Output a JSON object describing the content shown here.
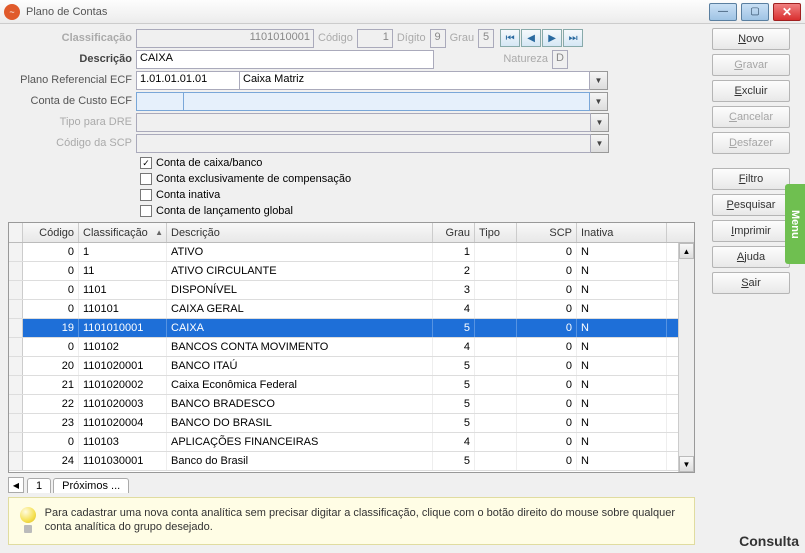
{
  "window": {
    "title": "Plano de Contas"
  },
  "labels": {
    "classificacao": "Classificação",
    "codigo": "Código",
    "digito": "Dígito",
    "grau": "Grau",
    "descricao": "Descrição",
    "natureza": "Natureza",
    "planoRef": "Plano Referencial ECF",
    "contaCusto": "Conta de Custo ECF",
    "tipoDRE": "Tipo para DRE",
    "codigoSCP": "Código da SCP"
  },
  "values": {
    "classificacao": "1101010001",
    "codigo": "1",
    "digito": "9",
    "grau": "5",
    "descricao": "CAIXA",
    "natureza": "D",
    "planoRefCod": "1.01.01.01.01",
    "planoRefDesc": "Caixa Matriz",
    "contaCusto": "",
    "tipoDRE": "",
    "codigoSCP": ""
  },
  "checks": [
    {
      "label": "Conta de caixa/banco",
      "checked": true
    },
    {
      "label": "Conta exclusivamente de compensação",
      "checked": false
    },
    {
      "label": "Conta inativa",
      "checked": false
    },
    {
      "label": "Conta de lançamento global",
      "checked": false
    }
  ],
  "grid": {
    "headers": {
      "codigo": "Código",
      "class": "Classificação",
      "desc": "Descrição",
      "grau": "Grau",
      "tipo": "Tipo",
      "scp": "SCP",
      "inativa": "Inativa"
    },
    "rows": [
      {
        "codigo": "0",
        "class": "1",
        "desc": "ATIVO",
        "grau": "1",
        "tipo": "",
        "scp": "0",
        "inat": "N",
        "sel": false
      },
      {
        "codigo": "0",
        "class": "11",
        "desc": "ATIVO CIRCULANTE",
        "grau": "2",
        "tipo": "",
        "scp": "0",
        "inat": "N",
        "sel": false
      },
      {
        "codigo": "0",
        "class": "1101",
        "desc": "DISPONÍVEL",
        "grau": "3",
        "tipo": "",
        "scp": "0",
        "inat": "N",
        "sel": false
      },
      {
        "codigo": "0",
        "class": "110101",
        "desc": "CAIXA GERAL",
        "grau": "4",
        "tipo": "",
        "scp": "0",
        "inat": "N",
        "sel": false
      },
      {
        "codigo": "19",
        "class": "1101010001",
        "desc": "CAIXA",
        "grau": "5",
        "tipo": "",
        "scp": "0",
        "inat": "N",
        "sel": true
      },
      {
        "codigo": "0",
        "class": "110102",
        "desc": "BANCOS CONTA MOVIMENTO",
        "grau": "4",
        "tipo": "",
        "scp": "0",
        "inat": "N",
        "sel": false
      },
      {
        "codigo": "20",
        "class": "1101020001",
        "desc": "BANCO ITAÚ",
        "grau": "5",
        "tipo": "",
        "scp": "0",
        "inat": "N",
        "sel": false
      },
      {
        "codigo": "21",
        "class": "1101020002",
        "desc": "Caixa Econômica Federal",
        "grau": "5",
        "tipo": "",
        "scp": "0",
        "inat": "N",
        "sel": false
      },
      {
        "codigo": "22",
        "class": "1101020003",
        "desc": "BANCO BRADESCO",
        "grau": "5",
        "tipo": "",
        "scp": "0",
        "inat": "N",
        "sel": false
      },
      {
        "codigo": "23",
        "class": "1101020004",
        "desc": "BANCO DO BRASIL",
        "grau": "5",
        "tipo": "",
        "scp": "0",
        "inat": "N",
        "sel": false
      },
      {
        "codigo": "0",
        "class": "110103",
        "desc": "APLICAÇÕES FINANCEIRAS",
        "grau": "4",
        "tipo": "",
        "scp": "0",
        "inat": "N",
        "sel": false
      },
      {
        "codigo": "24",
        "class": "1101030001",
        "desc": "Banco do Brasil",
        "grau": "5",
        "tipo": "",
        "scp": "0",
        "inat": "N",
        "sel": false
      }
    ]
  },
  "tabs": {
    "tab1": "1",
    "tab2": "Próximos ..."
  },
  "hint": "Para cadastrar uma nova conta analítica sem precisar digitar a classificação, clique com o botão direito do mouse sobre qualquer conta analítica do grupo desejado.",
  "buttons": {
    "novo": "Novo",
    "gravar": "Gravar",
    "excluir": "Excluir",
    "cancelar": "Cancelar",
    "desfazer": "Desfazer",
    "filtro": "Filtro",
    "pesquisar": "Pesquisar",
    "imprimir": "Imprimir",
    "ajuda": "Ajuda",
    "sair": "Sair"
  },
  "menuTab": "Menu",
  "status": "Consulta"
}
